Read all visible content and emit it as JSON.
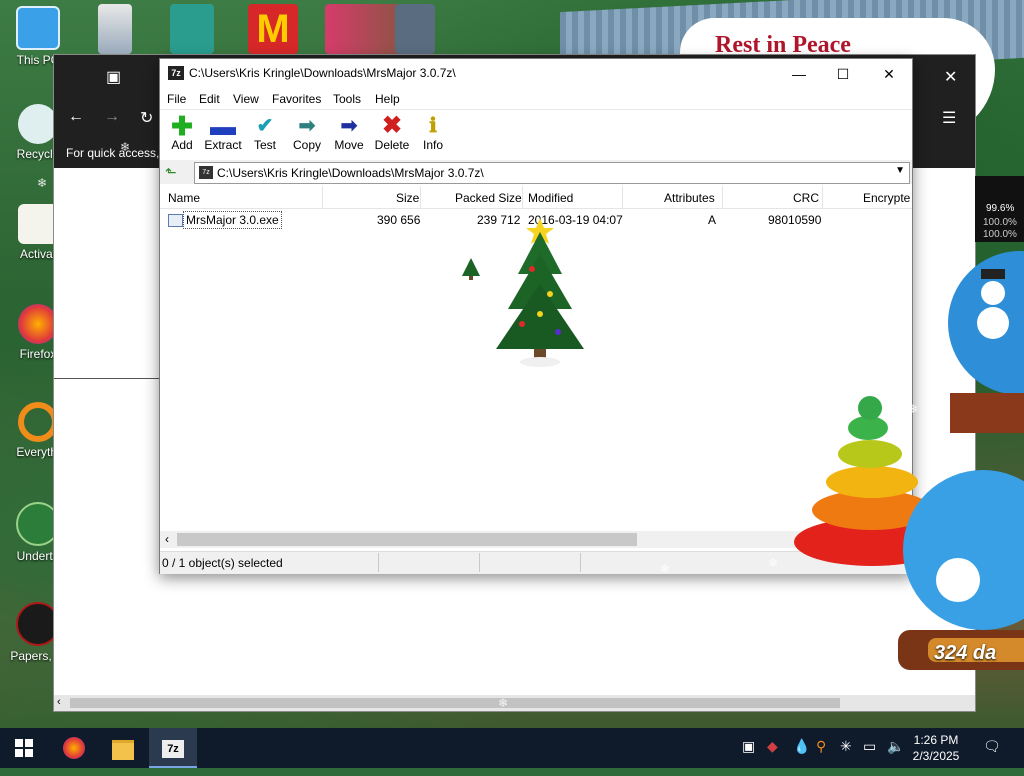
{
  "desktop": {
    "rip_sign": "Rest in Peace",
    "icons": [
      {
        "label": "This PC"
      },
      {
        "label": "Recycle"
      },
      {
        "label": "Activat"
      },
      {
        "label": "Firefox"
      },
      {
        "label": "Everythi"
      },
      {
        "label": "Underta"
      },
      {
        "label": "Papers, Pl"
      }
    ],
    "perf_readout": [
      "99.6%",
      "100.0%",
      "100.0%"
    ],
    "globe_counter": "324 da"
  },
  "explorer": {
    "hint": "For quick access, p"
  },
  "zip": {
    "title": "C:\\Users\\Kris Kringle\\Downloads\\MrsMajor 3.0.7z\\",
    "app_icon_text": "7z",
    "menu": [
      "File",
      "Edit",
      "View",
      "Favorites",
      "Tools",
      "Help"
    ],
    "toolbar": [
      {
        "label": "Add",
        "icon": "plus-icon",
        "color": "#1fae1f"
      },
      {
        "label": "Extract",
        "icon": "minus-icon",
        "color": "#1f3fbf"
      },
      {
        "label": "Test",
        "icon": "check-icon",
        "color": "#1aa0b5"
      },
      {
        "label": "Copy",
        "icon": "arrow-right-icon",
        "color": "#2f7f7f"
      },
      {
        "label": "Move",
        "icon": "arrow-right-icon",
        "color": "#1f2f9f"
      },
      {
        "label": "Delete",
        "icon": "x-icon",
        "color": "#d01f1f"
      },
      {
        "label": "Info",
        "icon": "info-icon",
        "color": "#c0a000"
      }
    ],
    "address": "C:\\Users\\Kris Kringle\\Downloads\\MrsMajor 3.0.7z\\",
    "columns": [
      "Name",
      "Size",
      "Packed Size",
      "Modified",
      "Attributes",
      "CRC",
      "Encrypte"
    ],
    "rows": [
      {
        "name": "MrsMajor 3.0.exe",
        "size": "390 656",
        "packed_size": "239 712",
        "modified": "2016-03-19 04:07",
        "attributes": "A",
        "crc": "98010590"
      }
    ],
    "status": "0 / 1 object(s) selected"
  },
  "taskbar": {
    "time": "1:26 PM",
    "date": "2/3/2025"
  }
}
